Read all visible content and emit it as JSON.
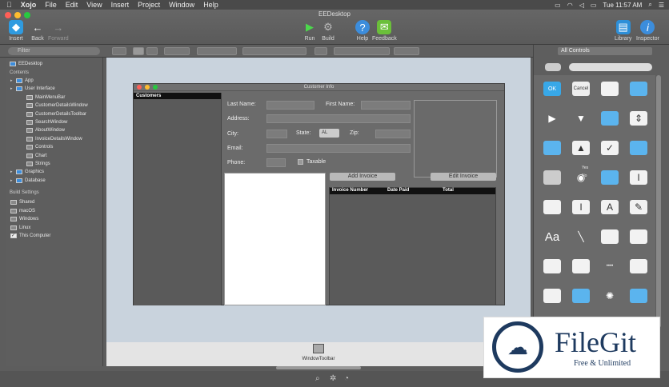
{
  "menubar": {
    "apple": "",
    "app": "Xojo",
    "items": [
      "File",
      "Edit",
      "View",
      "Insert",
      "Project",
      "Window",
      "Help"
    ],
    "clock": "Tue 11:57 AM"
  },
  "window": {
    "title": "EEDesktop"
  },
  "toolbar": {
    "insert": "Insert",
    "back": "Back",
    "forward": "Forward",
    "run": "Run",
    "build": "Build",
    "help": "Help",
    "feedback": "Feedback",
    "library": "Library",
    "inspector": "Inspector"
  },
  "filter": {
    "placeholder": "Filter"
  },
  "navigator": {
    "project": "EEDesktop",
    "contents_header": "Contents",
    "items": [
      {
        "label": "App",
        "indent": 1
      },
      {
        "label": "User Interface",
        "indent": 1
      },
      {
        "label": "MainMenuBar",
        "indent": 2
      },
      {
        "label": "CustomerDetailsWindow",
        "indent": 2
      },
      {
        "label": "CustomerDetailsToolbar",
        "indent": 2
      },
      {
        "label": "SearchWindow",
        "indent": 2
      },
      {
        "label": "AboutWindow",
        "indent": 2
      },
      {
        "label": "InvoiceDetailsWindow",
        "indent": 2
      },
      {
        "label": "Controls",
        "indent": 2
      },
      {
        "label": "Chart",
        "indent": 2
      },
      {
        "label": "Strings",
        "indent": 2
      },
      {
        "label": "Graphics",
        "indent": 1
      },
      {
        "label": "Database",
        "indent": 1
      }
    ],
    "build_header": "Build Settings",
    "build_items": [
      {
        "label": "Shared",
        "checked": false
      },
      {
        "label": "macOS",
        "checked": false
      },
      {
        "label": "Windows",
        "checked": false
      },
      {
        "label": "Linux",
        "checked": false
      },
      {
        "label": "This Computer",
        "checked": true
      }
    ]
  },
  "customer_window": {
    "title": "Customer Info",
    "list_header": "Customers",
    "last_name": "Last Name:",
    "first_name": "First Name:",
    "address": "Address:",
    "city": "City:",
    "state": "State:",
    "state_value": "AL",
    "zip": "Zip:",
    "email": "Email:",
    "phone": "Phone:",
    "taxable": "Taxable",
    "add_invoice": "Add Invoice",
    "edit_invoice": "Edit Invoice",
    "columns": [
      "Invoice Number",
      "Date Paid",
      "Total"
    ]
  },
  "bottom": {
    "window_toolbar": "WindowToolbar"
  },
  "library": {
    "dropdown": "All Controls",
    "ok_label": "OK",
    "cancel_label": "Cancel",
    "radio_yes": "Yes",
    "radio_no": "No",
    "aa": "Aa",
    "icon_colors": {
      "accent": "#38a8e8",
      "bg": "#5e5e5e"
    }
  },
  "watermark": {
    "brand": "FileGit",
    "tagline": "Free & Unlimited"
  }
}
